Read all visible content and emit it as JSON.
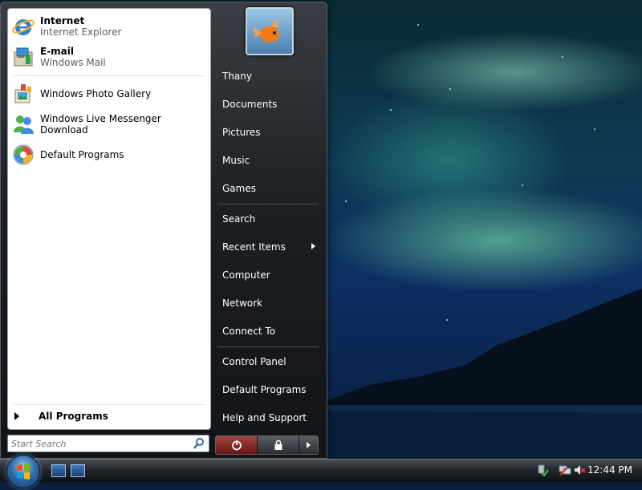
{
  "start_menu": {
    "pinned": [
      {
        "title": "Internet",
        "subtitle": "Internet Explorer",
        "icon": "internet-explorer-icon"
      },
      {
        "title": "E-mail",
        "subtitle": "Windows Mail",
        "icon": "windows-mail-icon"
      }
    ],
    "recent": [
      {
        "title": "Windows Photo Gallery",
        "icon": "photo-gallery-icon"
      },
      {
        "title": "Windows Live Messenger Download",
        "icon": "messenger-icon"
      },
      {
        "title": "Default Programs",
        "icon": "default-programs-icon"
      }
    ],
    "all_programs_label": "All Programs",
    "search_placeholder": "Start Search",
    "right_items": [
      {
        "label": "Thany"
      },
      {
        "label": "Documents"
      },
      {
        "label": "Pictures"
      },
      {
        "label": "Music"
      },
      {
        "label": "Games"
      },
      {
        "label": "Search"
      },
      {
        "label": "Recent Items"
      },
      {
        "label": "Computer"
      },
      {
        "label": "Network"
      },
      {
        "label": "Connect To"
      },
      {
        "label": "Control Panel"
      },
      {
        "label": "Default Programs"
      },
      {
        "label": "Help and Support"
      }
    ]
  },
  "taskbar": {
    "clock": "12:44 PM"
  },
  "colors": {
    "accent": "#2f6ea8",
    "power_button": "#8a2a25",
    "menu_dark": "#1c1f23"
  }
}
